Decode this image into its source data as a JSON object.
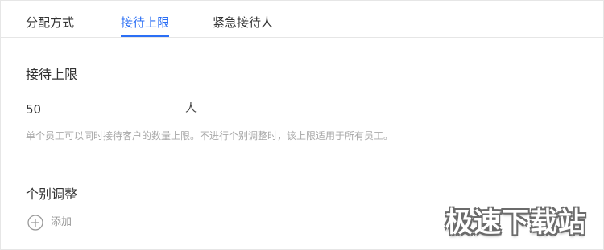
{
  "tabs": [
    {
      "label": "分配方式",
      "active": false
    },
    {
      "label": "接待上限",
      "active": true
    },
    {
      "label": "紧急接待人",
      "active": false
    }
  ],
  "limit_section": {
    "title": "接待上限",
    "input_value": "50",
    "unit": "人",
    "hint": "单个员工可以同时接待客户的数量上限。不进行个别调整时，该上限适用于所有员工。"
  },
  "adjust_section": {
    "title": "个别调整",
    "add_label": "添加",
    "add_icon": "plus-circle-icon"
  },
  "watermark": {
    "text": "极速下载站"
  },
  "colors": {
    "accent": "#2b6ff5",
    "text": "#333333",
    "muted": "#a8a8a8",
    "divider": "#e6e6e6"
  }
}
